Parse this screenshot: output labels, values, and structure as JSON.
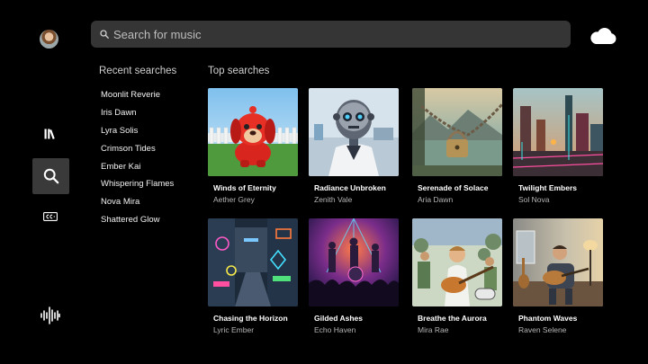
{
  "nav": {
    "items": [
      {
        "icon": "library-icon"
      },
      {
        "icon": "search-icon",
        "selected": true
      },
      {
        "icon": "closed-captions-icon"
      },
      {
        "icon": "audio-waveform-icon"
      }
    ]
  },
  "search": {
    "placeholder": "Search for music",
    "value": ""
  },
  "header": {
    "right_icon": "cloud-icon"
  },
  "recent": {
    "title": "Recent searches",
    "items": [
      "Moonlit Reverie",
      "Iris Dawn",
      "Lyra Solis",
      "Crimson Tides",
      "Ember Kai",
      "Whispering Flames",
      "Nova Mira",
      "Shattered Glow"
    ]
  },
  "top": {
    "title": "Top searches",
    "cards": [
      {
        "title": "Winds of Eternity",
        "artist": "Aether Grey"
      },
      {
        "title": "Radiance Unbroken",
        "artist": "Zenith Vale"
      },
      {
        "title": "Serenade of Solace",
        "artist": "Aria Dawn"
      },
      {
        "title": "Twilight Embers",
        "artist": "Sol Nova"
      },
      {
        "title": "Chasing the Horizon",
        "artist": "Lyric Ember"
      },
      {
        "title": "Gilded Ashes",
        "artist": "Echo Haven"
      },
      {
        "title": "Breathe the Aurora",
        "artist": "Mira Rae"
      },
      {
        "title": "Phantom Waves",
        "artist": "Raven Selene"
      }
    ]
  },
  "colors": {
    "background": "#000000",
    "search_bar": "#353535",
    "nav_selected": "#3a3a3a",
    "secondary_text": "#b5b5b5"
  }
}
